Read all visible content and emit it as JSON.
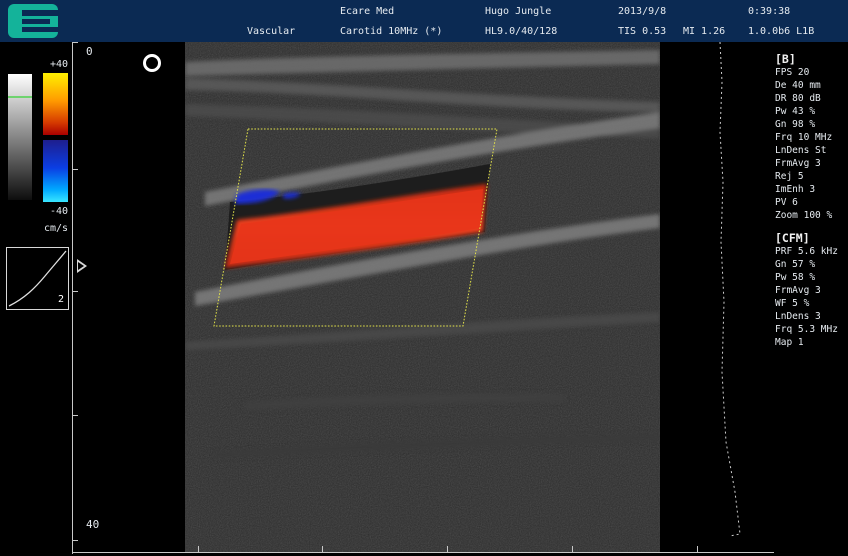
{
  "header": {
    "hospital": "Ecare Med",
    "patient": "Hugo Jungle",
    "date": "2013/9/8",
    "time": "0:39:38",
    "exam": "Vascular",
    "probe": "Carotid 10MHz (*)",
    "preset": "HL9.0/40/128",
    "tis": "TIS 0.53",
    "mi": "MI 1.26",
    "version": "1.0.0b6 L1B"
  },
  "colorbar": {
    "top_label": "+40",
    "bottom_label": "-40",
    "unit": "cm/s"
  },
  "curve": {
    "value": "2"
  },
  "depth": {
    "top": "0",
    "bottom": "40"
  },
  "b_mode": {
    "title": "[B]",
    "params": [
      "FPS 20",
      "De 40 mm",
      "DR 80 dB",
      "Pw 43 %",
      "Gn 98 %",
      "Frq 10 MHz",
      "LnDens St",
      "FrmAvg 3",
      "Rej 5",
      "ImEnh 3",
      "PV 6",
      "Zoom 100 %"
    ]
  },
  "cfm_mode": {
    "title": "[CFM]",
    "params": [
      "PRF 5.6 kHz",
      "Gn 57 %",
      "Pw 58 %",
      "FrmAvg 3",
      "WF 5 %",
      "LnDens 3",
      "Frq 5.3 MHz",
      "Map 1"
    ]
  },
  "colors": {
    "header_bg": "#0b2a53",
    "logo": "#14b39a",
    "flow_red": "#e8351a",
    "flow_blue": "#1b2fd6",
    "roi_outline": "#e3e34a"
  },
  "icons": [
    "logo-icon",
    "focus-ring-icon",
    "side-arrow-icon"
  ]
}
